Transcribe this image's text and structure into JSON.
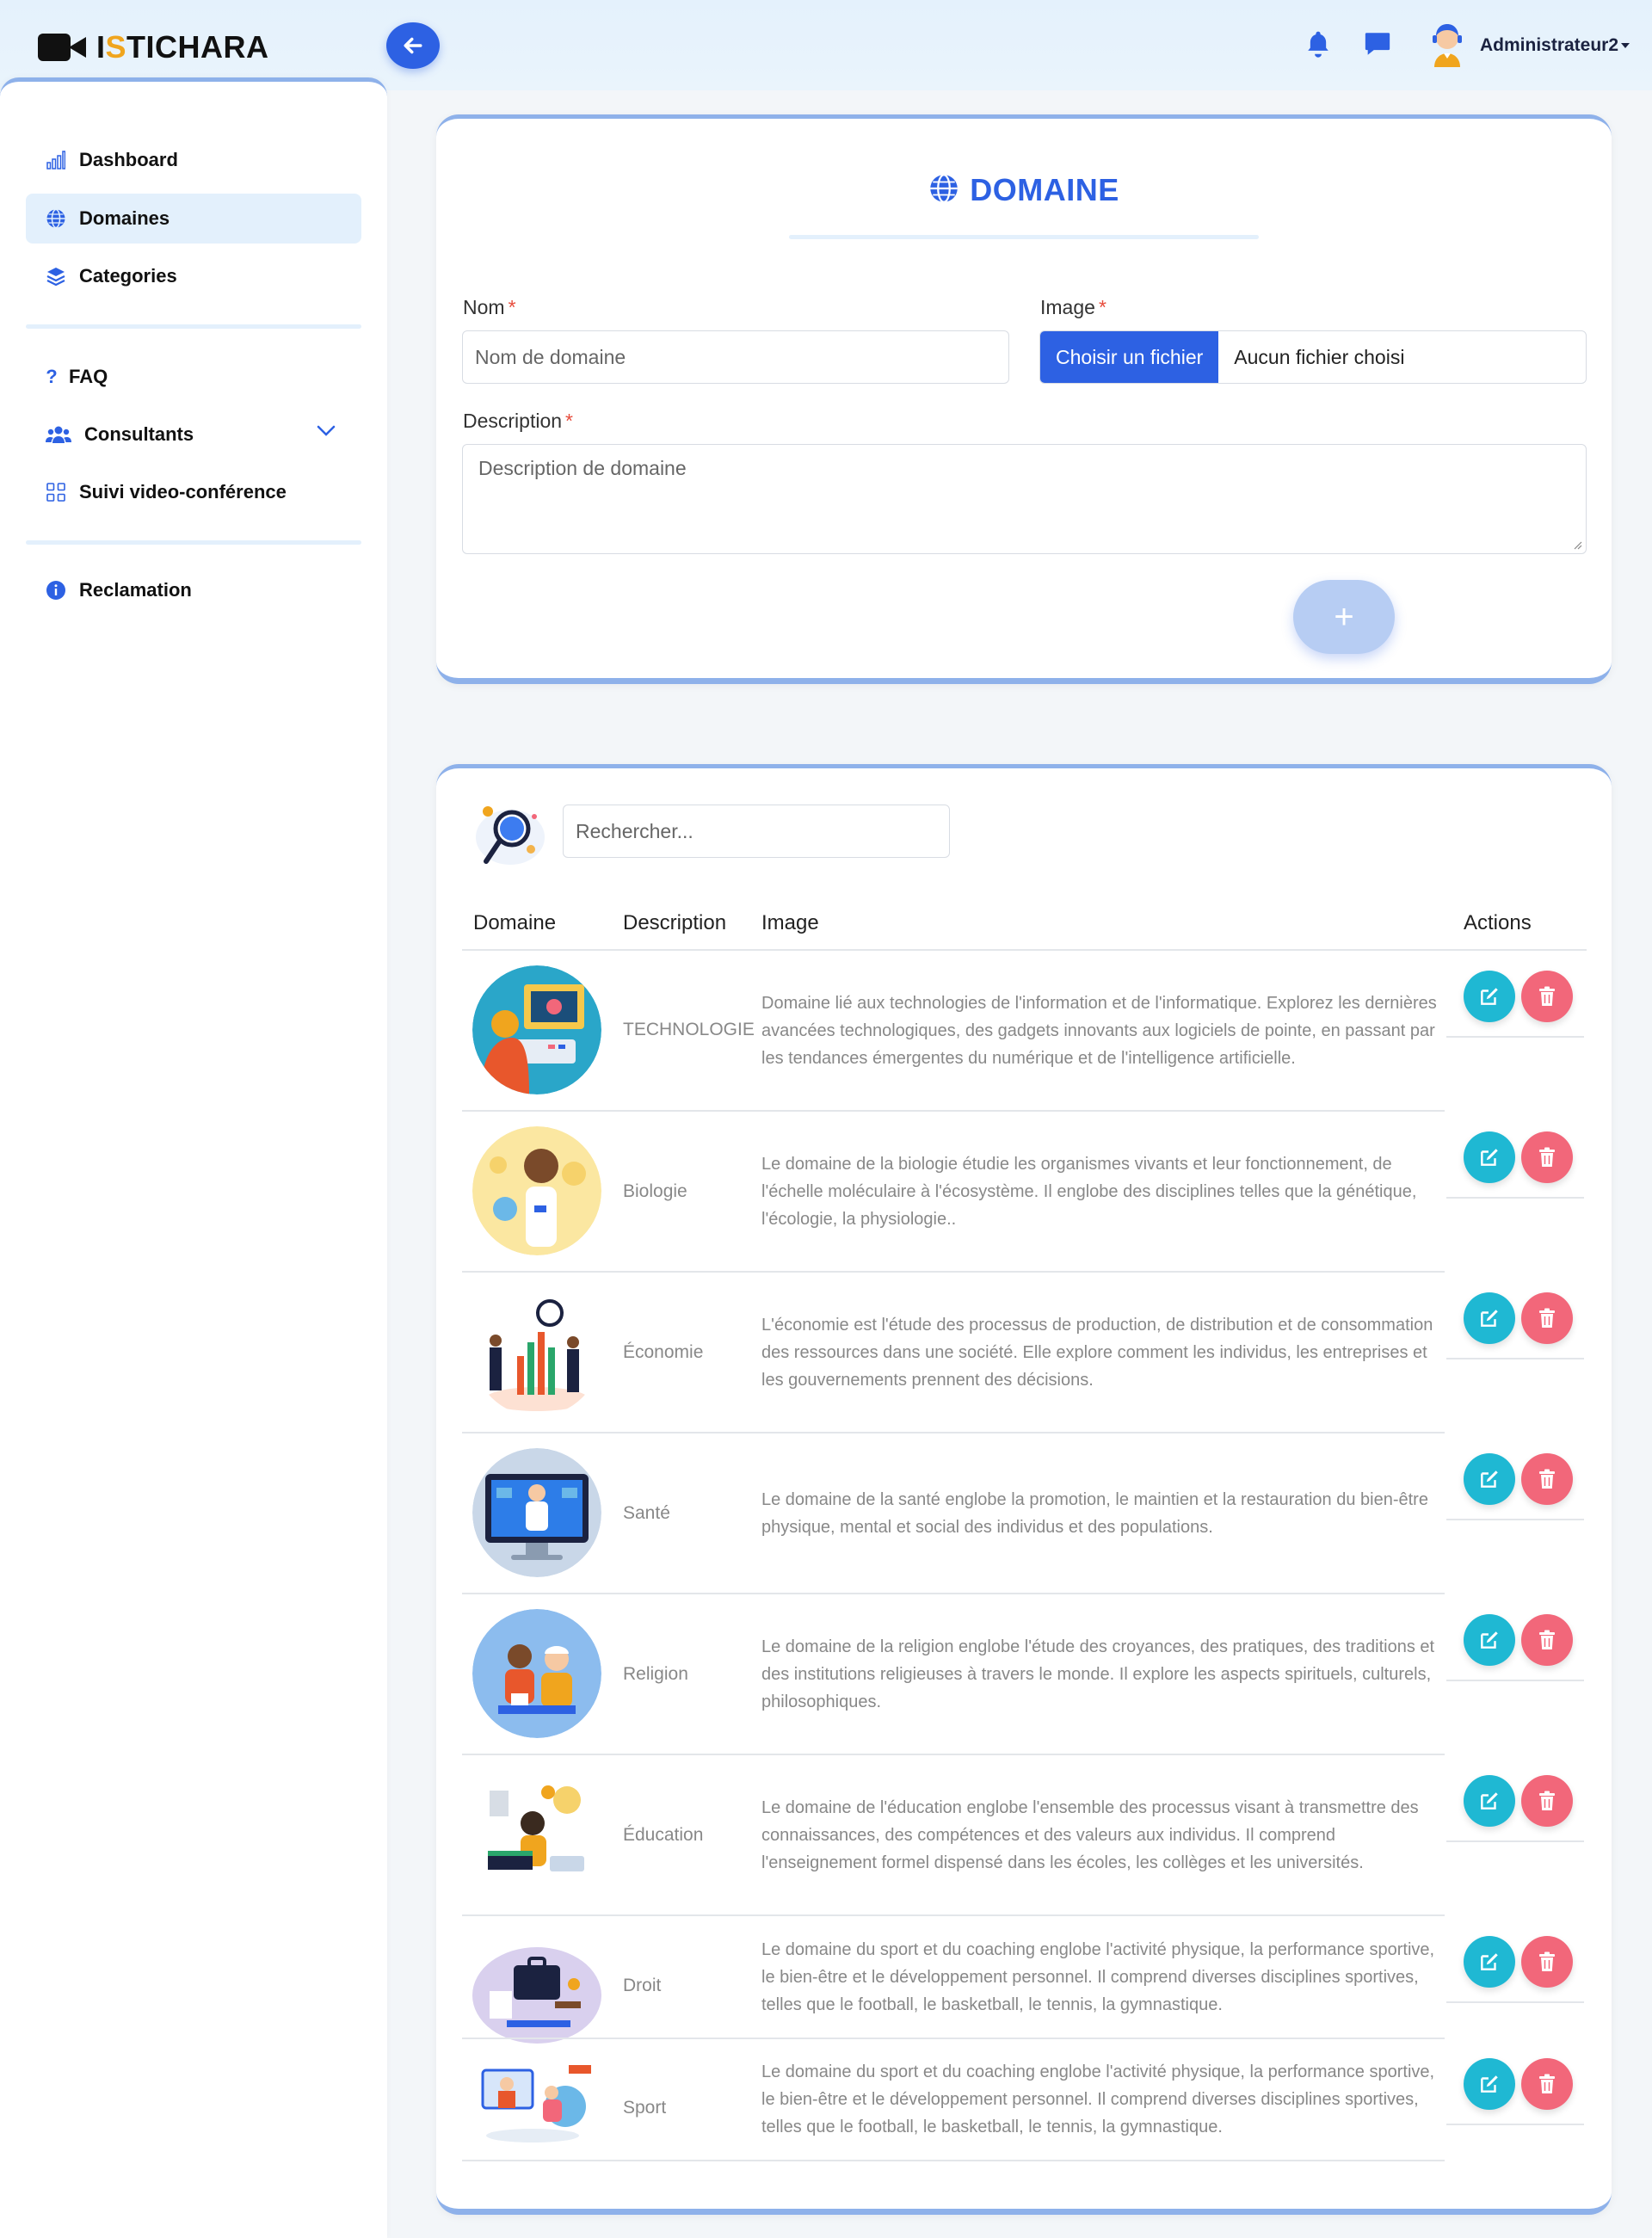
{
  "app": {
    "logo_prefix": "I",
    "logo_accent": "S",
    "logo_rest": "TICHARA"
  },
  "header": {
    "user_name": "Administrateur2"
  },
  "sidebar": {
    "items": [
      {
        "label": "Dashboard"
      },
      {
        "label": "Domaines"
      },
      {
        "label": "Categories"
      },
      {
        "label": "FAQ"
      },
      {
        "label": "Consultants"
      },
      {
        "label": "Suivi video-conférence"
      },
      {
        "label": "Reclamation"
      }
    ]
  },
  "form": {
    "title": "DOMAINE",
    "name_label": "Nom",
    "name_placeholder": "Nom de domaine",
    "image_label": "Image",
    "file_button": "Choisir un fichier",
    "file_status": "Aucun fichier choisi",
    "description_label": "Description",
    "description_placeholder": "Description de domaine",
    "required_mark": "*",
    "submit_label": "+"
  },
  "table": {
    "search_placeholder": "Rechercher...",
    "headers": [
      "Domaine",
      "Description",
      "Image",
      "Actions"
    ],
    "rows": [
      {
        "name": "TECHNOLOGIE",
        "description": "Domaine lié aux technologies de l'information et de l'informatique. Explorez les dernières avancées technologiques, des gadgets innovants aux logiciels de pointe, en passant par les tendances émergentes du numérique et de l'intelligence artificielle."
      },
      {
        "name": "Biologie",
        "description": "Le domaine de la biologie étudie les organismes vivants et leur fonctionnement, de l'échelle moléculaire à l'écosystème. Il englobe des disciplines telles que la génétique, l'écologie, la physiologie.."
      },
      {
        "name": "Économie",
        "description": "L'économie est l'étude des processus de production, de distribution et de consommation des ressources dans une société. Elle explore comment les individus, les entreprises et les gouvernements prennent des décisions."
      },
      {
        "name": "Santé",
        "description": "Le domaine de la santé englobe la promotion, le maintien et la restauration du bien-être physique, mental et social des individus et des populations."
      },
      {
        "name": "Religion",
        "description": "Le domaine de la religion englobe l'étude des croyances, des pratiques, des traditions et des institutions religieuses à travers le monde. Il explore les aspects spirituels, culturels, philosophiques."
      },
      {
        "name": "Éducation",
        "description": "Le domaine de l'éducation englobe l'ensemble des processus visant à transmettre des connaissances, des compétences et des valeurs aux individus. Il comprend l'enseignement formel dispensé dans les écoles, les collèges et les universités."
      },
      {
        "name": "Droit",
        "description": "Le domaine du sport et du coaching englobe l'activité physique, la performance sportive, le bien-être et le développement personnel. Il comprend diverses disciplines sportives, telles que le football, le basketball, le tennis, la gymnastique."
      },
      {
        "name": "Sport",
        "description": "Le domaine du sport et du coaching englobe l'activité physique, la performance sportive, le bien-être et le développement personnel. Il comprend diverses disciplines sportives, telles que le football, le basketball, le tennis, la gymnastique."
      }
    ]
  },
  "colors": {
    "primary": "#2d61e3",
    "accent": "#f0a51e",
    "edit": "#1fb8d3",
    "delete": "#f2677a",
    "card_border": "#8eb1ea"
  }
}
